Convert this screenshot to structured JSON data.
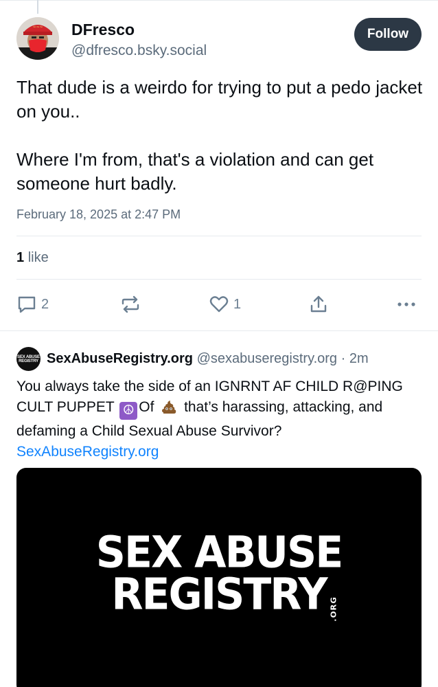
{
  "post": {
    "author_name": "DFresco",
    "author_handle": "@dfresco.bsky.social",
    "follow_label": "Follow",
    "text_paragraph_1": "That dude is a weirdo for trying to put a pedo jacket on you..",
    "text_paragraph_2": "Where I'm from, that's a violation and can get someone hurt badly.",
    "timestamp": "February 18, 2025 at 2:47 PM",
    "likes_count": "1",
    "likes_label": "like",
    "actions": {
      "reply_count": "2",
      "repost_count": "",
      "like_count": "1"
    }
  },
  "quoted": {
    "author_name": "SexAbuseRegistry.org",
    "author_handle": "@sexabuseregistry.org",
    "separator": "·",
    "time_ago": "2m",
    "avatar_line1": "SEX ABUSE",
    "avatar_line2": "REGISTRY",
    "text_part1": "You always take the side of an IGNRNT AF CHILD R@PING CULT PUPPET",
    "text_part2": "Of",
    "text_part3": "that’s harassing, attacking, and defaming a Child Sexual Abuse Survivor?",
    "link_text": "SexAbuseRegistry.org",
    "embed_line1": "SEX ABUSE",
    "embed_line2": "REGISTRY",
    "embed_org": ".ORG"
  },
  "icons": {
    "reply": "speech-bubble-icon",
    "repost": "repost-arrows-icon",
    "like": "heart-icon",
    "share": "share-upload-icon",
    "more": "ellipsis-icon"
  },
  "colors": {
    "follow_button_bg": "#2c3845",
    "link": "#1083fe",
    "muted_text": "#5b6b7b",
    "action_icon": "#6b7f92"
  }
}
